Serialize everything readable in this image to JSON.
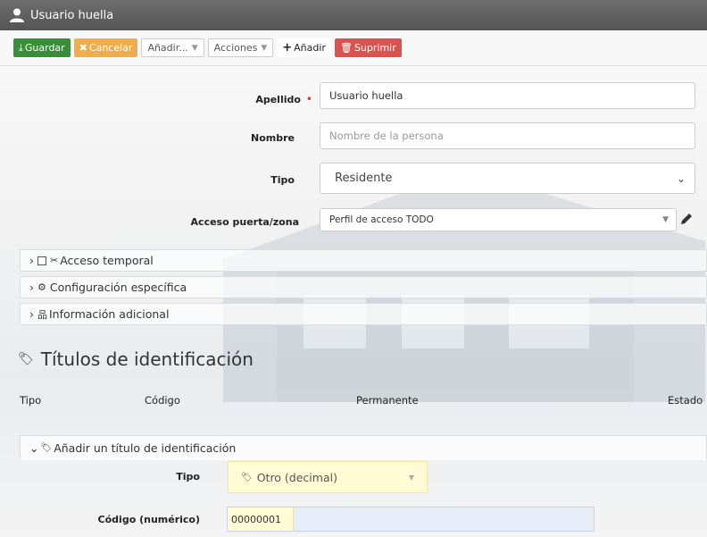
{
  "window": {
    "title": "Usuario huella"
  },
  "toolbar": {
    "save": "Guardar",
    "cancel": "Cancelar",
    "add_menu": "Añadir...",
    "actions_menu": "Acciones",
    "add": "Añadir",
    "delete": "Suprimir"
  },
  "form": {
    "apellido": {
      "label": "Apellido",
      "required_mark": "•",
      "value": "Usuario huella"
    },
    "nombre": {
      "label": "Nombre",
      "placeholder": "Nombre de la persona"
    },
    "tipo": {
      "label": "Tipo",
      "value": "Residente"
    },
    "acceso": {
      "label": "Acceso puerta/zona",
      "value": "Perfil de acceso TODO"
    }
  },
  "sections": {
    "acceso_temporal": "Acceso temporal",
    "config": "Configuración específica",
    "info": "Información adicional"
  },
  "titulos": {
    "title": "Títulos de identificación",
    "columns": [
      "Tipo",
      "Código",
      "Permanente",
      "Estado"
    ],
    "add_section": "Añadir un título de identificación",
    "tipo_label": "Tipo",
    "tipo_value": "Otro (decimal)",
    "codigo_label": "Código (numérico)",
    "codigo_value": "00000001"
  }
}
